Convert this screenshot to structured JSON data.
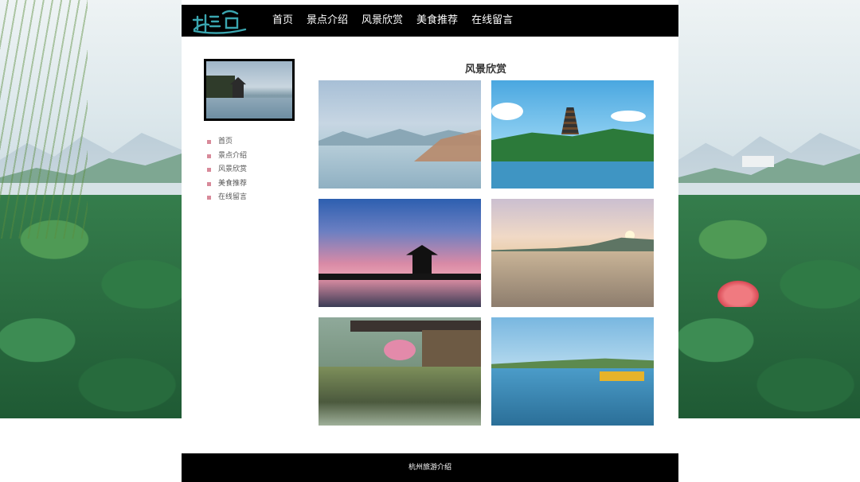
{
  "header": {
    "logo_icon": "west-lake-logo",
    "nav": [
      "首页",
      "景点介绍",
      "风景欣赏",
      "美食推荐",
      "在线留言"
    ]
  },
  "sidebar": {
    "thumbnail_icon": "pagoda-lake-photo",
    "items": [
      "首页",
      "景点介绍",
      "风景欣赏",
      "美食推荐",
      "在线留言"
    ],
    "bullet_color": "#d88a9a"
  },
  "gallery": {
    "title": "风景欣赏",
    "photos": [
      "lake-bridge-photo",
      "leifeng-pagoda-photo",
      "sunset-pavilion-photo",
      "lake-sunrise-photo",
      "garden-pond-photo",
      "lake-boat-photo"
    ]
  },
  "footer": {
    "text": "杭州旅游介绍"
  },
  "colors": {
    "bar": "#000000",
    "page": "#ffffff",
    "title": "#333333"
  }
}
